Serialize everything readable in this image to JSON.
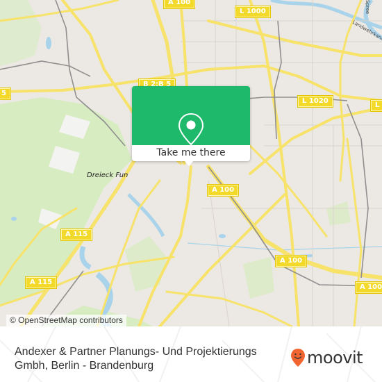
{
  "map": {
    "colors": {
      "land": "#ece8e3",
      "park": "#d7ecc1",
      "water": "#a8d3ea",
      "road": "#f7e26a",
      "rail": "#8f8f8f"
    },
    "road_labels": [
      {
        "id": "a100-top",
        "text": "A 100"
      },
      {
        "id": "l1000",
        "text": "L 1000"
      },
      {
        "id": "b2b5-center",
        "text": "B 2;B 5"
      },
      {
        "id": "b2b5-left",
        "text": "5"
      },
      {
        "id": "l1020",
        "text": "L 1020"
      },
      {
        "id": "l-right",
        "text": "L"
      },
      {
        "id": "a100-mid",
        "text": "A 100"
      },
      {
        "id": "a115-upper",
        "text": "A 115"
      },
      {
        "id": "a115-lower",
        "text": "A 115"
      },
      {
        "id": "a100-lower",
        "text": "A 100"
      },
      {
        "id": "a100-right",
        "text": "A 100"
      }
    ],
    "place_labels": [
      {
        "id": "dreieck",
        "text": "Dreieck Fun"
      }
    ],
    "water_labels": [
      {
        "id": "landwehrkanal",
        "text": "Landwehrkanal"
      },
      {
        "id": "spree",
        "text": "Spree"
      }
    ],
    "attribution": "© OpenStreetMap contributors"
  },
  "popup": {
    "icon": "location-pin-icon",
    "cta_label": "Take me there",
    "accent_color": "#1fb96b"
  },
  "footer": {
    "title": "Andexer & Partner Planungs- Und Projektierungs Gmbh, Berlin - Brandenburg",
    "brand": {
      "name": "moovit",
      "icon": "moovit-smiley-pin-icon",
      "color": "#f26530"
    }
  }
}
